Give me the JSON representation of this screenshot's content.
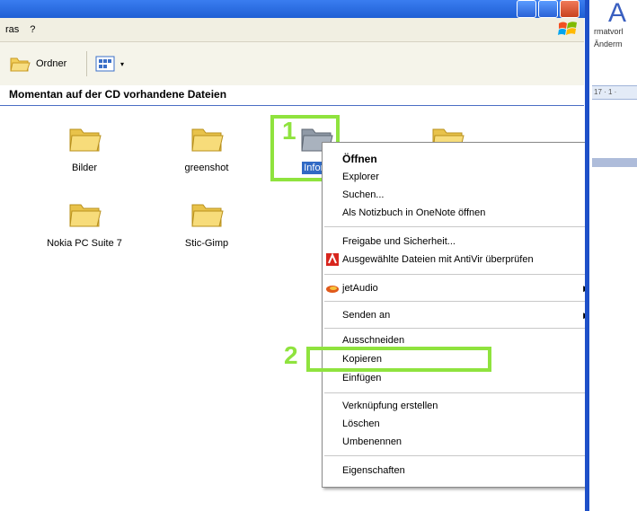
{
  "menubar": {
    "items": [
      "ras",
      "?"
    ]
  },
  "toolbar": {
    "folders_label": "Ordner"
  },
  "address": {
    "text": "Momentan auf der CD vorhandene Dateien"
  },
  "files": [
    {
      "label": "Bilder"
    },
    {
      "label": "greenshot"
    },
    {
      "label": "Infom"
    },
    {
      "label": ""
    },
    {
      "label": "Nokia PC Suite 7"
    },
    {
      "label": "Stic-Gimp"
    }
  ],
  "annotations": {
    "step1": "1",
    "step2": "2"
  },
  "context_menu": {
    "items": [
      {
        "label": "Öffnen"
      },
      {
        "label": "Explorer"
      },
      {
        "label": "Suchen..."
      },
      {
        "label": "Als Notizbuch in OneNote öffnen"
      },
      {
        "label": "Freigabe und Sicherheit..."
      },
      {
        "label": "Ausgewählte Dateien mit AntiVir überprüfen"
      },
      {
        "label": "jetAudio"
      },
      {
        "label": "Senden an"
      },
      {
        "label": "Ausschneiden"
      },
      {
        "label": "Kopieren"
      },
      {
        "label": "Einfügen"
      },
      {
        "label": "Verknüpfung erstellen"
      },
      {
        "label": "Löschen"
      },
      {
        "label": "Umbenennen"
      },
      {
        "label": "Eigenschaften"
      }
    ]
  },
  "right_window": {
    "big_letter": "A",
    "line1": "rmatvorl",
    "line2": "Änderm",
    "ruler": "17 · 1 ·"
  },
  "colors": {
    "titlebar": "#1f5fd4",
    "highlight": "#8fe33e",
    "selection": "#316ac5"
  }
}
